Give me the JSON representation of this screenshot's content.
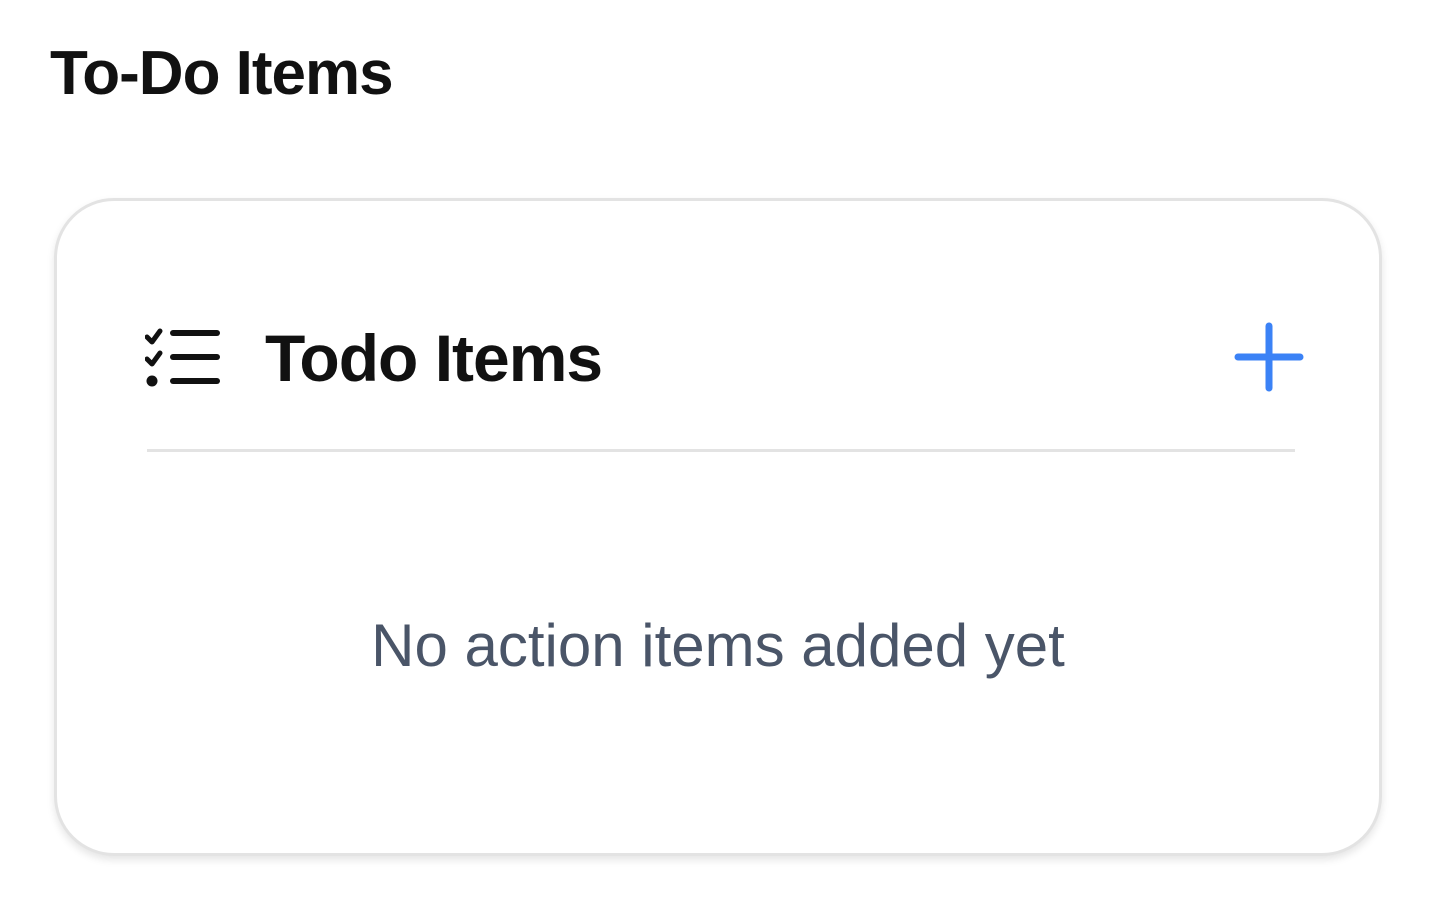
{
  "page": {
    "title": "To-Do Items"
  },
  "card": {
    "icon": "checklist-icon",
    "title": "Todo Items",
    "add_icon": "plus-icon",
    "empty_message": "No action items added yet"
  },
  "colors": {
    "accent": "#3b82f6",
    "text_primary": "#111111",
    "text_muted": "#4a5568",
    "border": "#e3e3e3"
  }
}
